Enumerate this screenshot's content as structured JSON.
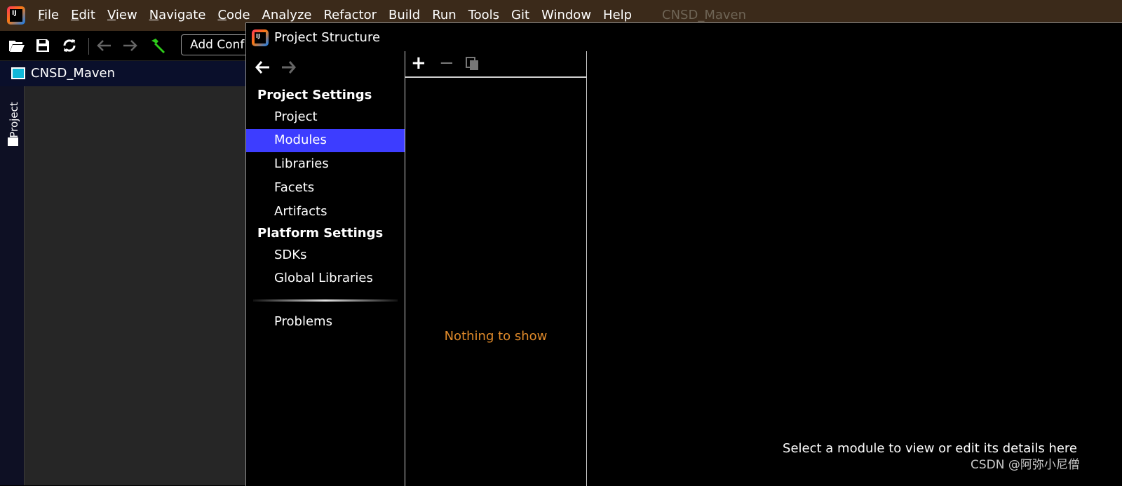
{
  "app": {
    "logo_text": "IJ",
    "window_title": "CNSD_Maven"
  },
  "menu": [
    {
      "mnemonic": "F",
      "rest": "ile"
    },
    {
      "mnemonic": "E",
      "rest": "dit"
    },
    {
      "mnemonic": "V",
      "rest": "iew"
    },
    {
      "mnemonic": "N",
      "rest": "avigate"
    },
    {
      "mnemonic": "C",
      "rest": "ode"
    },
    {
      "mnemonic": "",
      "rest": "Analyze"
    },
    {
      "mnemonic": "",
      "rest": "Refactor"
    },
    {
      "mnemonic": "",
      "rest": "Build"
    },
    {
      "mnemonic": "",
      "rest": "Run"
    },
    {
      "mnemonic": "",
      "rest": "Tools"
    },
    {
      "mnemonic": "",
      "rest": "Git"
    },
    {
      "mnemonic": "",
      "rest": "Window"
    },
    {
      "mnemonic": "",
      "rest": "Help"
    }
  ],
  "toolbar": {
    "add_config_label": "Add Conf",
    "icons": [
      "open-folder-icon",
      "save-icon",
      "sync-icon",
      "back-arrow-icon",
      "forward-arrow-icon",
      "build-hammer-icon"
    ]
  },
  "navbar": {
    "project_name": "CNSD_Maven"
  },
  "sidebar": {
    "project_tab": "Project"
  },
  "dialog": {
    "title": "Project Structure",
    "sections": {
      "project_settings": "Project Settings",
      "platform_settings": "Platform Settings"
    },
    "project_items": [
      "Project",
      "Modules",
      "Libraries",
      "Facets",
      "Artifacts"
    ],
    "platform_items": [
      "SDKs",
      "Global Libraries"
    ],
    "problems": "Problems",
    "selected": "Modules",
    "list_empty_text": "Nothing to show",
    "details_hint": "Select a module to view or edit its details here"
  },
  "watermark": "CSDN @阿弥小尼僧",
  "colors": {
    "menubar_bg": "#3b2a1a",
    "selection": "#3d3dff",
    "empty_text": "#e08a2a"
  }
}
